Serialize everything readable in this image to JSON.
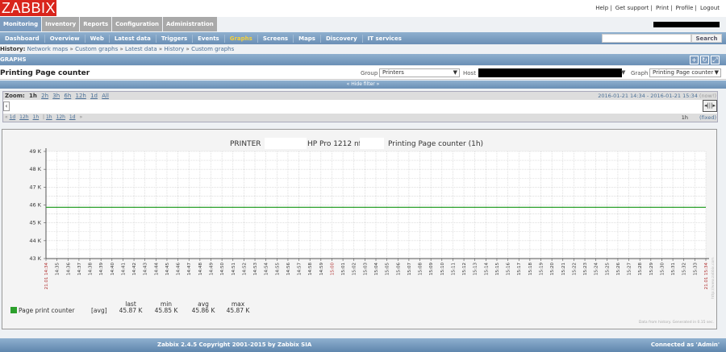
{
  "header": {
    "logo": "ZABBIX",
    "links": [
      "Help",
      "Get support",
      "Print",
      "Profile",
      "Logout"
    ]
  },
  "main_menu": [
    {
      "label": "Monitoring",
      "active": true
    },
    {
      "label": "Inventory"
    },
    {
      "label": "Reports"
    },
    {
      "label": "Configuration"
    },
    {
      "label": "Administration"
    }
  ],
  "sub_menu": [
    {
      "label": "Dashboard"
    },
    {
      "label": "Overview"
    },
    {
      "label": "Web"
    },
    {
      "label": "Latest data"
    },
    {
      "label": "Triggers"
    },
    {
      "label": "Events"
    },
    {
      "label": "Graphs",
      "active": true
    },
    {
      "label": "Screens"
    },
    {
      "label": "Maps"
    },
    {
      "label": "Discovery"
    },
    {
      "label": "IT services"
    }
  ],
  "search": {
    "value": "",
    "button": "Search"
  },
  "history": {
    "label": "History:",
    "items": [
      "Network maps",
      "Custom graphs",
      "Latest data",
      "History",
      "Custom graphs"
    ],
    "sep": "»"
  },
  "section": {
    "title": "GRAPHS"
  },
  "page_title": "Printing Page counter",
  "filters": {
    "group_label": "Group",
    "group_value": "Printers",
    "host_label": "Host",
    "graph_label": "Graph",
    "graph_value": "Printing Page counter"
  },
  "hide_filter": "« Hide filter »",
  "timeline": {
    "zoom_label": "Zoom:",
    "zoom_options": [
      "1h",
      "2h",
      "3h",
      "6h",
      "12h",
      "1d",
      "All"
    ],
    "zoom_active": "1h",
    "nav_left": [
      "1d",
      "12h",
      "1h"
    ],
    "nav_right": [
      "1h",
      "12h",
      "1d"
    ],
    "from": "2016-01-21 14:34",
    "to": "2016-01-21 15:34",
    "now": "(now!)",
    "period": "1h",
    "fixed": "(fixed)"
  },
  "chart_data": {
    "type": "line",
    "title_parts": [
      "PRINTER",
      "HP Pro 1212 nf",
      "Printing Page counter (1h)"
    ],
    "ylim": [
      43000,
      49000
    ],
    "yticks": [
      "43 K",
      "44 K",
      "45 K",
      "46 K",
      "47 K",
      "48 K",
      "49 K"
    ],
    "x_start_label": "21.01 14:34",
    "x_end_label": "21.01 15:34",
    "x_minutes_start": "14:34",
    "x_range_minutes": 60,
    "series": [
      {
        "name": "Page print counter",
        "func": "[avg]",
        "color": "#2ca02c",
        "values": [
          45870,
          45870
        ]
      }
    ],
    "stats": {
      "headers": [
        "last",
        "min",
        "avg",
        "max"
      ],
      "values": [
        "45.87 K",
        "45.85 K",
        "45.86 K",
        "45.87 K"
      ]
    },
    "footnote": "Data from history. Generated in 0.15 sec.",
    "watermark": "http://www.zabbix.com"
  },
  "footer": {
    "copyright": "Zabbix 2.4.5 Copyright 2001-2015 by Zabbix SIA",
    "connected": "Connected as 'Admin'"
  }
}
